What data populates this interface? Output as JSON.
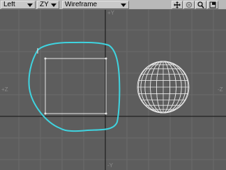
{
  "toolbar": {
    "view_label": "Left",
    "axis_mode_label": "ZY",
    "shading_label": "Wireframe",
    "icons": [
      "move-view-icon",
      "rotate-view-icon",
      "zoom-view-icon",
      "maximize-view-icon"
    ]
  },
  "axes": {
    "top": "+Y",
    "bottom": "-Y",
    "left": "+Z",
    "right": "-Z"
  },
  "colors": {
    "background": "#5d5d5d",
    "grid": "#6a6a6a",
    "axis": "#111111",
    "wire": "#e8e8e8",
    "curve": "#3fd4e0"
  }
}
